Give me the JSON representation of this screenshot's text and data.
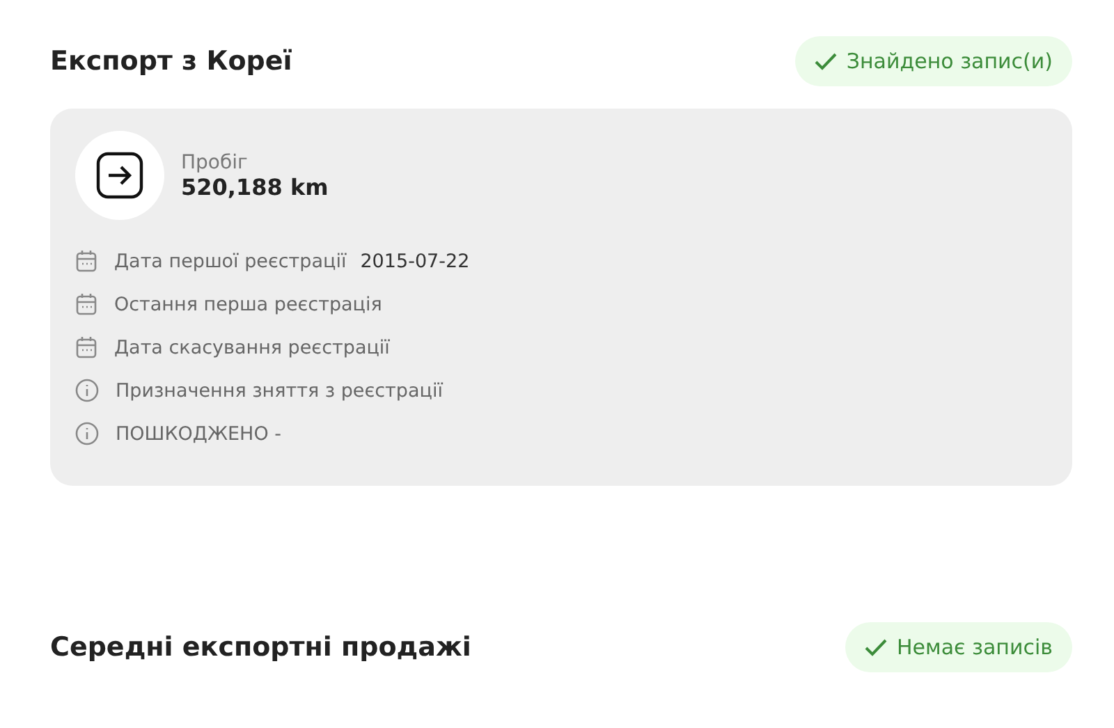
{
  "sections": [
    {
      "title": "Експорт з Кореї",
      "status": {
        "label": "Знайдено запис(и)",
        "found": true
      },
      "card": {
        "mileage": {
          "label": "Пробіг",
          "value": "520,188 km"
        },
        "rows": [
          {
            "kind": "calendar",
            "label": "Дата першої реєстрації",
            "value": "2015-07-22"
          },
          {
            "kind": "calendar",
            "label": "Остання перша реєстрація"
          },
          {
            "kind": "calendar",
            "label": "Дата скасування реєстрації"
          },
          {
            "kind": "info",
            "label": "Призначення зняття з реєстрації"
          },
          {
            "kind": "info",
            "label": "ПОШКОДЖЕНО -"
          }
        ]
      }
    },
    {
      "title": "Середні експортні продажі",
      "status": {
        "label": "Немає записів",
        "found": true
      }
    }
  ]
}
